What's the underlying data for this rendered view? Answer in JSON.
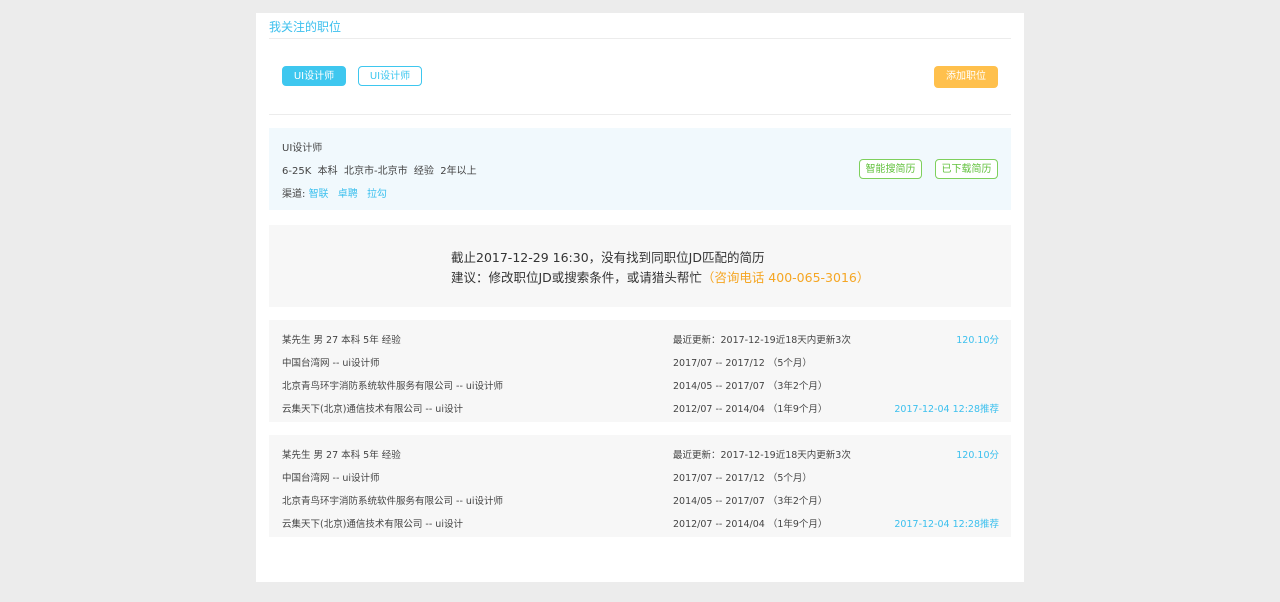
{
  "header": {
    "title": "我关注的职位"
  },
  "tags": [
    {
      "label": "UI设计师",
      "active": true
    },
    {
      "label": "UI设计师",
      "active": false
    }
  ],
  "add_button": "添加职位",
  "job": {
    "title": "UI设计师",
    "meta": "6-25K  本科  北京市-北京市  经验  2年以上",
    "channels_label": "渠道:",
    "channels": [
      "智联",
      "卓聘",
      "拉勾"
    ],
    "smart_search_button": "智能搜简历",
    "downloaded_button": "已下载简历"
  },
  "notice": {
    "line1": "截止2017-12-29 16:30，没有找到同职位JD匹配的简历",
    "line2_prefix": "建议：修改职位JD或搜索条件，或请猎头帮忙",
    "line2_phone": "（咨询电话 400-065-3016）"
  },
  "resumes": [
    {
      "summary": "某先生   男  27  本科  5年  经验",
      "update": "最近更新：2017-12-19近18天内更新3次",
      "score": "120.10分",
      "jobs": [
        {
          "company": "中国台湾网   -- ui设计师",
          "period": "2017/07 -- 2017/12   （5个月）"
        },
        {
          "company": "北京青鸟环宇消防系统软件服务有限公司   -- ui设计师",
          "period": "2014/05 -- 2017/07   （3年2个月）"
        },
        {
          "company": "云集天下(北京)通信技术有限公司   -- ui设计",
          "period": "2012/07 -- 2014/04   （1年9个月）"
        }
      ],
      "recommend": "2017-12-04 12:28推荐"
    },
    {
      "summary": "某先生   男  27  本科  5年  经验",
      "update": "最近更新：2017-12-19近18天内更新3次",
      "score": "120.10分",
      "jobs": [
        {
          "company": "中国台湾网   -- ui设计师",
          "period": "2017/07 -- 2017/12   （5个月）"
        },
        {
          "company": "北京青鸟环宇消防系统软件服务有限公司   -- ui设计师",
          "period": "2014/05 -- 2017/07   （3年2个月）"
        },
        {
          "company": "云集天下(北京)通信技术有限公司   -- ui设计",
          "period": "2012/07 -- 2014/04   （1年9个月）"
        }
      ],
      "recommend": "2017-12-04 12:28推荐"
    }
  ],
  "colors": {
    "accent": "#3ec7ef",
    "add_button": "#ffc04c",
    "green_button": "#62c13d",
    "phone": "#f5a623",
    "page_bg": "#ececec"
  }
}
